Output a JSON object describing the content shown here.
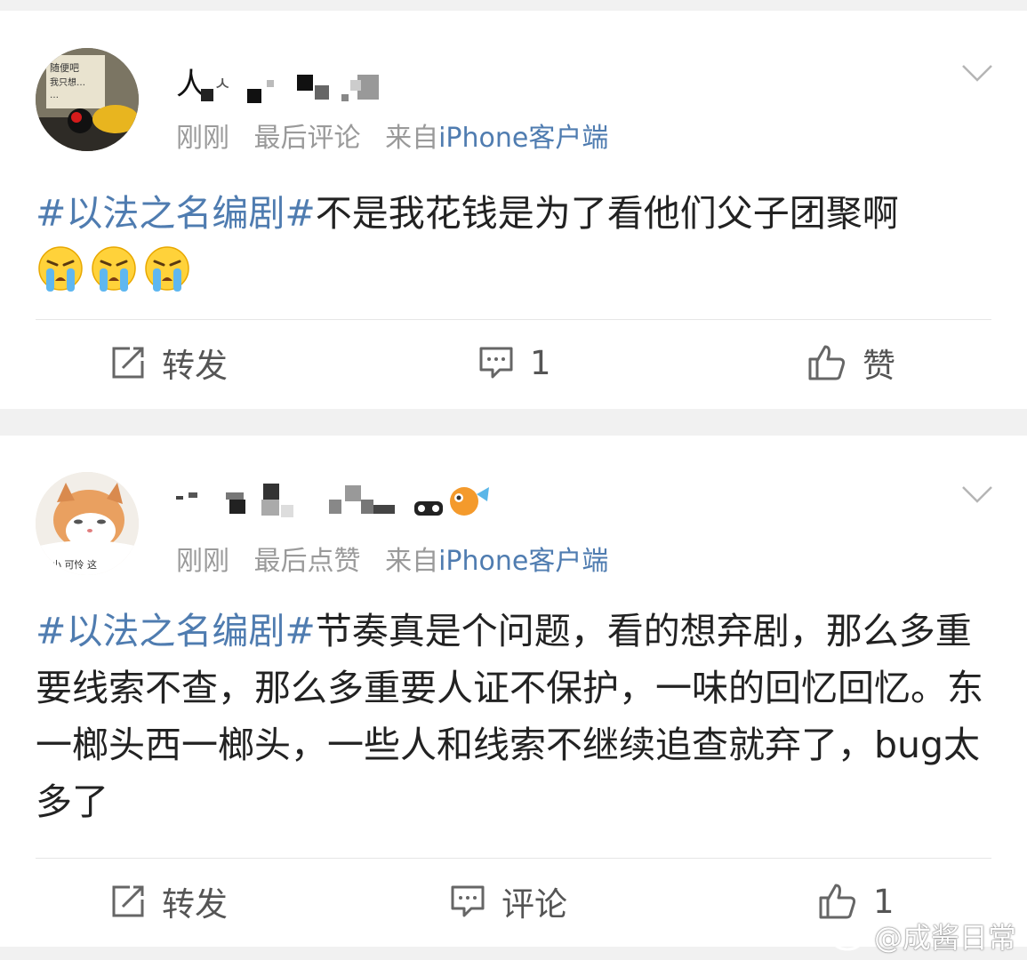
{
  "posts": [
    {
      "username": "",
      "time": "刚刚",
      "status": "最后评论",
      "source_prefix": "来自",
      "source": "iPhone客户端",
      "hashtag": "#以法之名编剧#",
      "text": "不是我花钱是为了看他们父子团聚啊",
      "emojis": [
        "crying-face-emoji",
        "crying-face-emoji",
        "crying-face-emoji"
      ],
      "actions": {
        "repost_label": "转发",
        "comment_label": "1",
        "like_label": "赞"
      }
    },
    {
      "username": "",
      "time": "刚刚",
      "status": "最后点赞",
      "source_prefix": "来自",
      "source": "iPhone客户端",
      "hashtag": "#以法之名编剧#",
      "text": "节奏真是个问题，看的想弃剧，那么多重要线索不查，那么多重要人证不保护，一味的回忆回忆。东一榔头西一榔头，一些人和线索不继续追查就弃了，bug太多了",
      "actions": {
        "repost_label": "转发",
        "comment_label": "评论",
        "like_label": "1"
      }
    }
  ],
  "watermark": "@成酱日常",
  "colors": {
    "link": "#4f7cb0",
    "meta": "#9a9a9a",
    "background": "#f1f1f1"
  }
}
